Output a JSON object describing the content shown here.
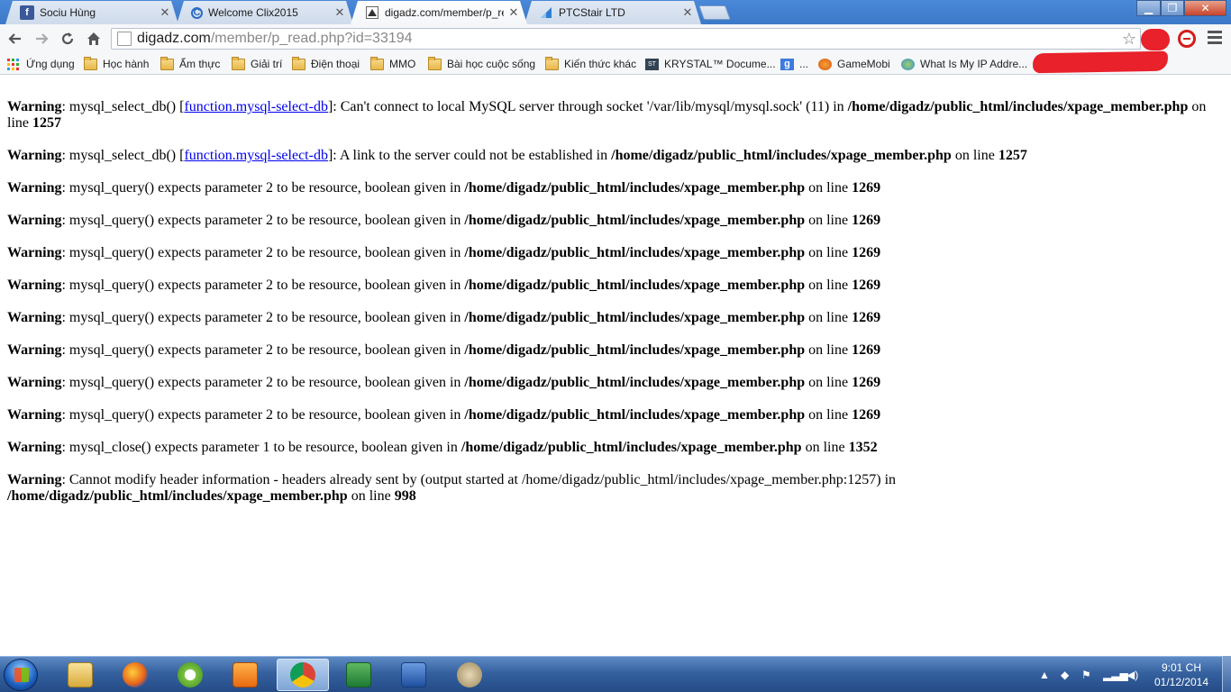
{
  "tabs": [
    {
      "title": "Sociu Hùng",
      "icon": "facebook-icon",
      "active": false
    },
    {
      "title": "Welcome Clix2015",
      "icon": "clix-icon",
      "active": false
    },
    {
      "title": "digadz.com/member/p_re",
      "icon": "digadz-icon",
      "active": true
    },
    {
      "title": "PTCStair LTD",
      "icon": "ptcstair-icon",
      "active": false
    }
  ],
  "address_bar": {
    "host": "digadz.com",
    "path": "/member/p_read.php?id=33194"
  },
  "bookmarks": [
    {
      "label": "Ứng dụng",
      "icon": "apps-grid-icon"
    },
    {
      "label": "Học hành",
      "icon": "folder-icon"
    },
    {
      "label": "Ẩm thực",
      "icon": "folder-icon"
    },
    {
      "label": "Giải trí",
      "icon": "folder-icon"
    },
    {
      "label": "Điện thoại",
      "icon": "folder-icon"
    },
    {
      "label": "MMO",
      "icon": "folder-icon"
    },
    {
      "label": "Bài học cuộc sống",
      "icon": "folder-icon"
    },
    {
      "label": "Kiến thức khác",
      "icon": "folder-icon"
    },
    {
      "label": "KRYSTAL™ Docume...",
      "icon": "krystal-icon"
    },
    {
      "label": "...",
      "icon": "google-icon"
    },
    {
      "label": "GameMobi",
      "icon": "gamemobi-icon"
    },
    {
      "label": "What Is My IP Addre...",
      "icon": "globe-icon"
    }
  ],
  "warnings": [
    {
      "label": "Warning",
      "pre": ": mysql_select_db() [",
      "link": "function.mysql-select-db",
      "post": "]: Can't connect to local MySQL server through socket '/var/lib/mysql/mysql.sock' (11) in ",
      "file": "/home/digadz/public_html/includes/xpage_member.php",
      "on_line": " on line ",
      "line": "1257"
    },
    {
      "label": "Warning",
      "pre": ": mysql_select_db() [",
      "link": "function.mysql-select-db",
      "post": "]: A link to the server could not be established in ",
      "file": "/home/digadz/public_html/includes/xpage_member.php",
      "on_line": " on line ",
      "line": "1257"
    },
    {
      "label": "Warning",
      "pre": ": mysql_query() expects parameter 2 to be resource, boolean given in ",
      "link": "",
      "post": "",
      "file": "/home/digadz/public_html/includes/xpage_member.php",
      "on_line": " on line ",
      "line": "1269"
    },
    {
      "label": "Warning",
      "pre": ": mysql_query() expects parameter 2 to be resource, boolean given in ",
      "link": "",
      "post": "",
      "file": "/home/digadz/public_html/includes/xpage_member.php",
      "on_line": " on line ",
      "line": "1269"
    },
    {
      "label": "Warning",
      "pre": ": mysql_query() expects parameter 2 to be resource, boolean given in ",
      "link": "",
      "post": "",
      "file": "/home/digadz/public_html/includes/xpage_member.php",
      "on_line": " on line ",
      "line": "1269"
    },
    {
      "label": "Warning",
      "pre": ": mysql_query() expects parameter 2 to be resource, boolean given in ",
      "link": "",
      "post": "",
      "file": "/home/digadz/public_html/includes/xpage_member.php",
      "on_line": " on line ",
      "line": "1269"
    },
    {
      "label": "Warning",
      "pre": ": mysql_query() expects parameter 2 to be resource, boolean given in ",
      "link": "",
      "post": "",
      "file": "/home/digadz/public_html/includes/xpage_member.php",
      "on_line": " on line ",
      "line": "1269"
    },
    {
      "label": "Warning",
      "pre": ": mysql_query() expects parameter 2 to be resource, boolean given in ",
      "link": "",
      "post": "",
      "file": "/home/digadz/public_html/includes/xpage_member.php",
      "on_line": " on line ",
      "line": "1269"
    },
    {
      "label": "Warning",
      "pre": ": mysql_query() expects parameter 2 to be resource, boolean given in ",
      "link": "",
      "post": "",
      "file": "/home/digadz/public_html/includes/xpage_member.php",
      "on_line": " on line ",
      "line": "1269"
    },
    {
      "label": "Warning",
      "pre": ": mysql_query() expects parameter 2 to be resource, boolean given in ",
      "link": "",
      "post": "",
      "file": "/home/digadz/public_html/includes/xpage_member.php",
      "on_line": " on line ",
      "line": "1269"
    },
    {
      "label": "Warning",
      "pre": ": mysql_close() expects parameter 1 to be resource, boolean given in ",
      "link": "",
      "post": "",
      "file": "/home/digadz/public_html/includes/xpage_member.php",
      "on_line": " on line ",
      "line": "1352"
    },
    {
      "label": "Warning",
      "pre": ": Cannot modify header information - headers already sent by (output started at /home/digadz/public_html/includes/xpage_member.php:1257) in ",
      "link": "",
      "post": "",
      "file": "/home/digadz/public_html/includes/xpage_member.php",
      "on_line": " on line ",
      "line": "998"
    }
  ],
  "taskbar": {
    "apps": [
      {
        "name": "file-explorer-icon",
        "active": false
      },
      {
        "name": "firefox-icon",
        "active": false
      },
      {
        "name": "coccoc-icon",
        "active": false
      },
      {
        "name": "media-player-icon",
        "active": false
      },
      {
        "name": "chrome-icon",
        "active": true
      },
      {
        "name": "excel-icon",
        "active": false
      },
      {
        "name": "word-icon",
        "active": false
      },
      {
        "name": "app-icon",
        "active": false
      }
    ],
    "clock_time": "9:01 CH",
    "clock_date": "01/12/2014"
  },
  "colors": {
    "link": "#0000ee",
    "tabstrip": "#4a88d8",
    "taskbar": "#35619f"
  }
}
